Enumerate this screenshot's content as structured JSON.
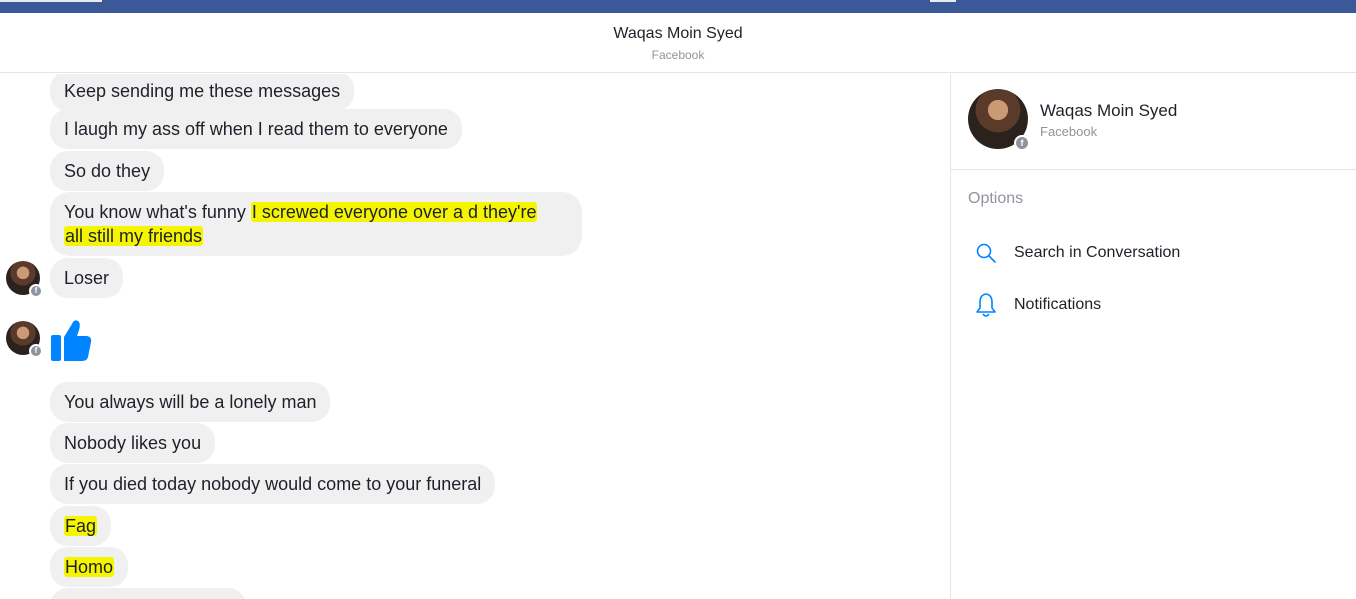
{
  "conversation": {
    "title": "Waqas Moin Syed",
    "subtitle": "Facebook"
  },
  "messages": [
    {
      "text": "Keep sending me these messages"
    },
    {
      "text": "I laugh my ass off when  I read them to everyone"
    },
    {
      "text": "So do they"
    },
    {
      "text_plain": "You know what's funny ",
      "text_highlight_1": "I screwed everyone over a d they're",
      "text_highlight_2": "all still my friends"
    },
    {
      "text": "Loser"
    },
    {
      "sticker": "thumbs-up-icon"
    },
    {
      "text": "You always will be a lonely man"
    },
    {
      "text": "Nobody likes you"
    },
    {
      "text": "If you died today nobody would come to your funeral"
    },
    {
      "text": "Fag"
    },
    {
      "text": "Homo"
    }
  ],
  "sidebar": {
    "name": "Waqas Moin Syed",
    "network": "Facebook",
    "options_heading": "Options",
    "options": [
      {
        "label": "Search in Conversation",
        "icon": "search-icon"
      },
      {
        "label": "Notifications",
        "icon": "bell-icon"
      }
    ]
  },
  "colors": {
    "brand_bar": "#3b5998",
    "bubble": "#f1f0f0",
    "highlight": "#f5f500",
    "like_blue": "#0084ff"
  }
}
